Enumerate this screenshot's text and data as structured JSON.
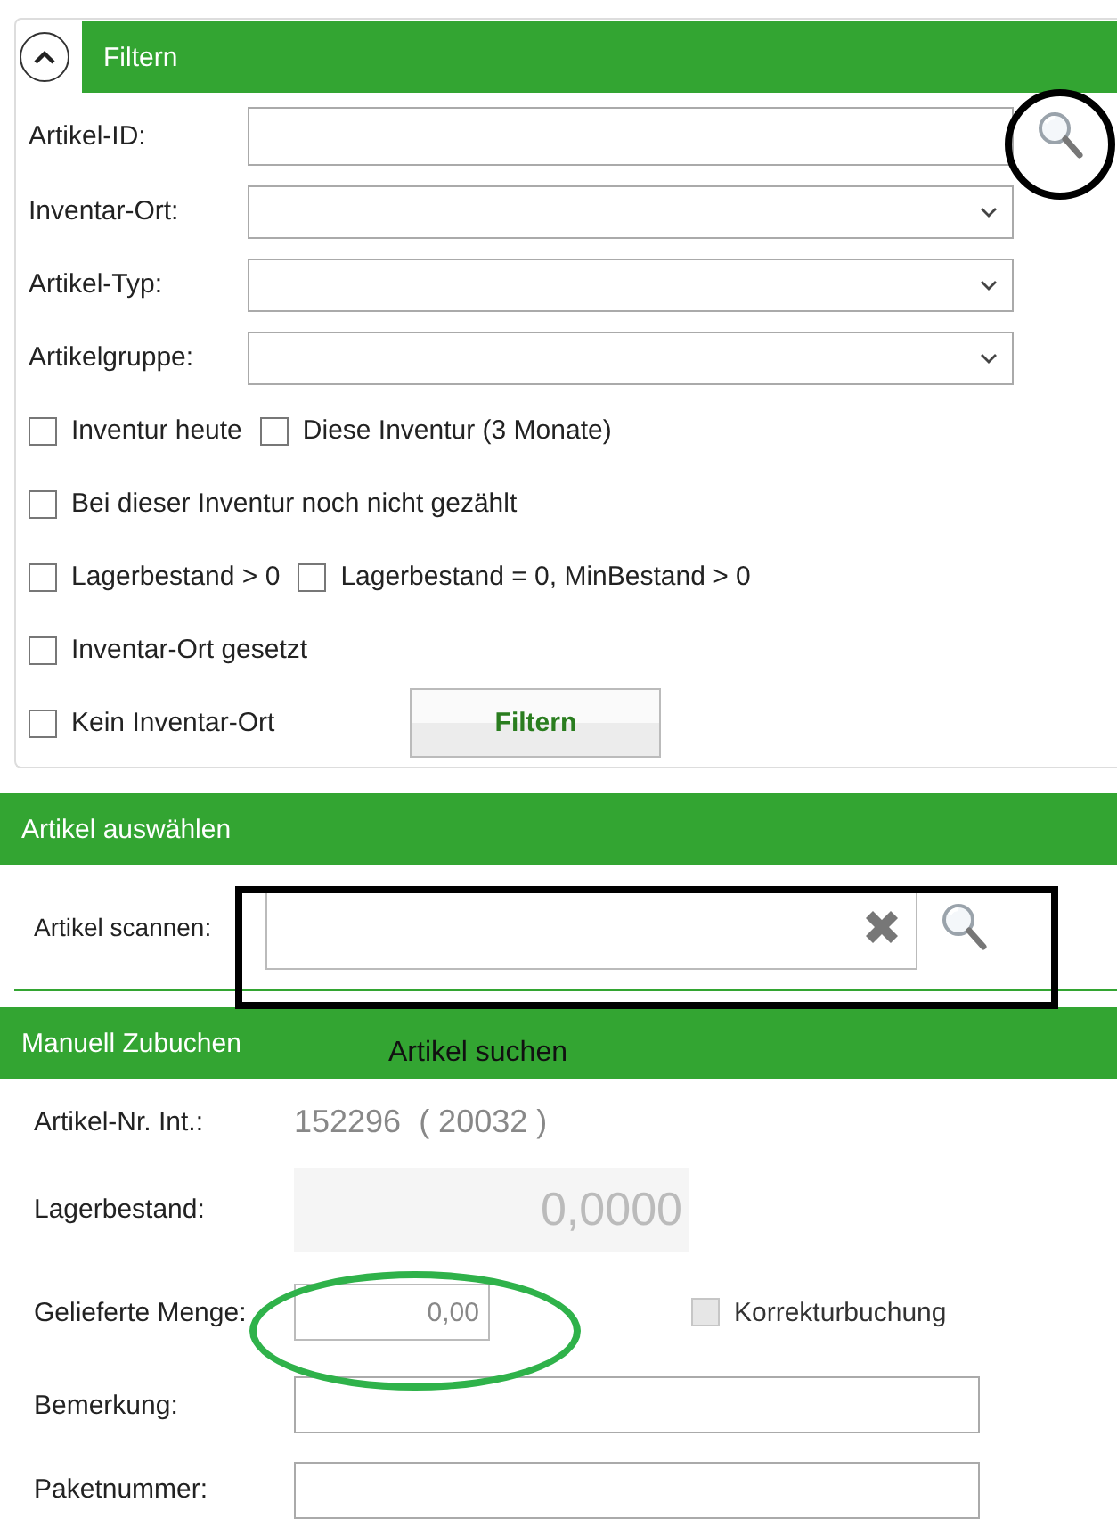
{
  "filter_panel": {
    "title": "Filtern",
    "expanded": true,
    "fields": [
      {
        "label": "Artikel-ID:",
        "kind": "search"
      },
      {
        "label": "Inventar-Ort:",
        "kind": "dropdown"
      },
      {
        "label": "Artikel-Typ:",
        "kind": "dropdown"
      },
      {
        "label": "Artikelgruppe:",
        "kind": "dropdown"
      }
    ],
    "checkbox_rows": [
      [
        {
          "label": "Inventur heute",
          "checked": false
        },
        {
          "label": "Diese Inventur (3 Monate)",
          "checked": false
        }
      ],
      [
        {
          "label": "Bei dieser Inventur noch nicht gezählt",
          "checked": false
        }
      ],
      [
        {
          "label": "Lagerbestand > 0",
          "checked": false
        },
        {
          "label": "Lagerbestand = 0, MinBestand > 0",
          "checked": false
        }
      ],
      [
        {
          "label": "Inventar-Ort gesetzt",
          "checked": false
        }
      ],
      [
        {
          "label": "Kein Inventar-Ort",
          "checked": false
        }
      ]
    ],
    "filter_button": "Filtern"
  },
  "select_panel": {
    "title": "Artikel auswählen",
    "scan_label": "Artikel scannen:"
  },
  "booking_panel": {
    "title": "Manuell Zubuchen",
    "article_number_label": "Artikel-Nr. Int.:",
    "article_number": "152296  ( 20032 )",
    "stock_label": "Lagerbestand:",
    "stock": "0,0000",
    "quantity_label": "Gelieferte Menge:",
    "quantity": "0,00",
    "correction": {
      "label": "Korrekturbuchung",
      "checked": false,
      "disabled": true
    },
    "remark_label": "Bemerkung:",
    "package_label": "Paketnummer:"
  },
  "annotations": [
    {
      "kind": "circle"
    },
    {
      "kind": "rectangle"
    },
    {
      "kind": "ellipse"
    },
    {
      "kind": "note",
      "text": "Artikel suchen"
    }
  ]
}
